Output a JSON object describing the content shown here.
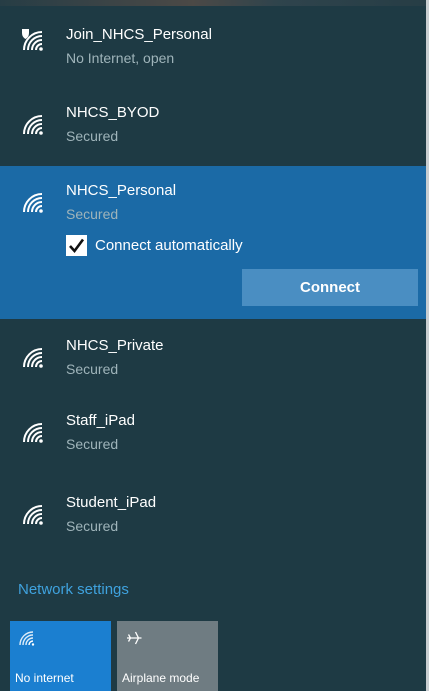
{
  "networks": [
    {
      "name": "Join_NHCS_Personal",
      "status": "No Internet, open",
      "icon": "wifi-shield-icon"
    },
    {
      "name": "NHCS_BYOD",
      "status": "Secured",
      "icon": "wifi-secured-icon"
    },
    {
      "name": "NHCS_Personal",
      "status": "Secured",
      "icon": "wifi-secured-icon",
      "selected": true,
      "connect_automatically_label": "Connect automatically",
      "connect_automatically_checked": true,
      "connect_label": "Connect"
    },
    {
      "name": "NHCS_Private",
      "status": "Secured",
      "icon": "wifi-secured-icon"
    },
    {
      "name": "Staff_iPad",
      "status": "Secured",
      "icon": "wifi-secured-icon"
    },
    {
      "name": "Student_iPad",
      "status": "Secured",
      "icon": "wifi-secured-icon"
    }
  ],
  "network_settings_label": "Network settings",
  "quick_actions": [
    {
      "label": "No internet",
      "icon": "wifi-icon",
      "active": true
    },
    {
      "label": "Airplane mode",
      "icon": "airplane-icon",
      "active": false
    }
  ],
  "colors": {
    "panel_background": "#1e3a44",
    "selected_background": "#1b6aa6",
    "connect_button": "#4a8ec2",
    "link": "#3fa2de",
    "active_tile": "#1b7fd0",
    "inactive_tile": "#6f7c82"
  }
}
